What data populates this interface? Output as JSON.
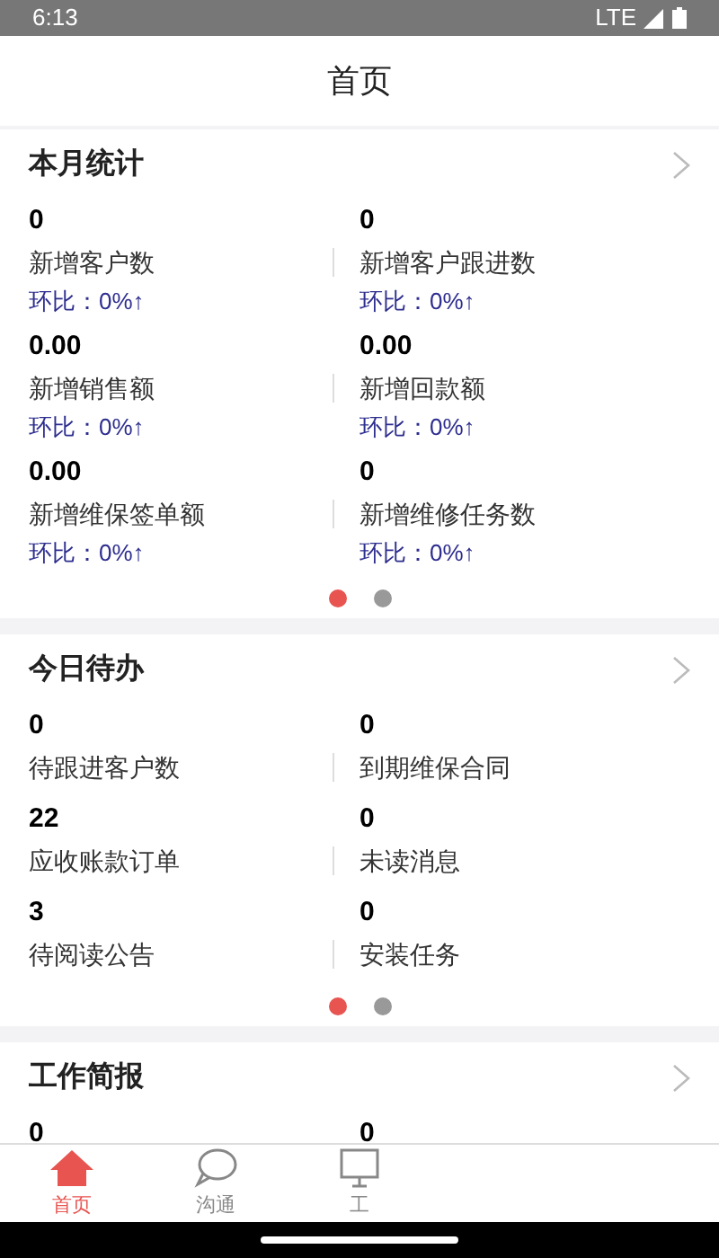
{
  "status_bar": {
    "time": "6:13",
    "network": "LTE"
  },
  "header": {
    "title": "首页"
  },
  "sections": [
    {
      "title": "本月统计",
      "stats": [
        {
          "value": "0",
          "label": "新增客户数",
          "change": "环比：0%↑"
        },
        {
          "value": "0",
          "label": "新增客户跟进数",
          "change": "环比：0%↑"
        },
        {
          "value": "0.00",
          "label": "新增销售额",
          "change": "环比：0%↑"
        },
        {
          "value": "0.00",
          "label": "新增回款额",
          "change": "环比：0%↑"
        },
        {
          "value": "0.00",
          "label": "新增维保签单额",
          "change": "环比：0%↑"
        },
        {
          "value": "0",
          "label": "新增维修任务数",
          "change": "环比：0%↑"
        }
      ],
      "pages": [
        {
          "selected": true
        },
        {
          "selected": false
        }
      ]
    },
    {
      "title": "今日待办",
      "stats": [
        {
          "value": "0",
          "label": "待跟进客户数"
        },
        {
          "value": "0",
          "label": "到期维保合同"
        },
        {
          "value": "22",
          "label": "应收账款订单"
        },
        {
          "value": "0",
          "label": "未读消息"
        },
        {
          "value": "3",
          "label": "待阅读公告"
        },
        {
          "value": "0",
          "label": "安装任务"
        }
      ],
      "pages": [
        {
          "selected": true
        },
        {
          "selected": false
        }
      ]
    },
    {
      "title": "工作简报",
      "stats": [
        {
          "value": "0"
        },
        {
          "value": "0"
        }
      ]
    }
  ],
  "tab_bar": [
    {
      "kind": "home",
      "label": "首页",
      "selected": true
    },
    {
      "kind": "chat",
      "label": "沟通",
      "selected": false
    },
    {
      "kind": "desk",
      "label": "工",
      "selected": false
    }
  ]
}
